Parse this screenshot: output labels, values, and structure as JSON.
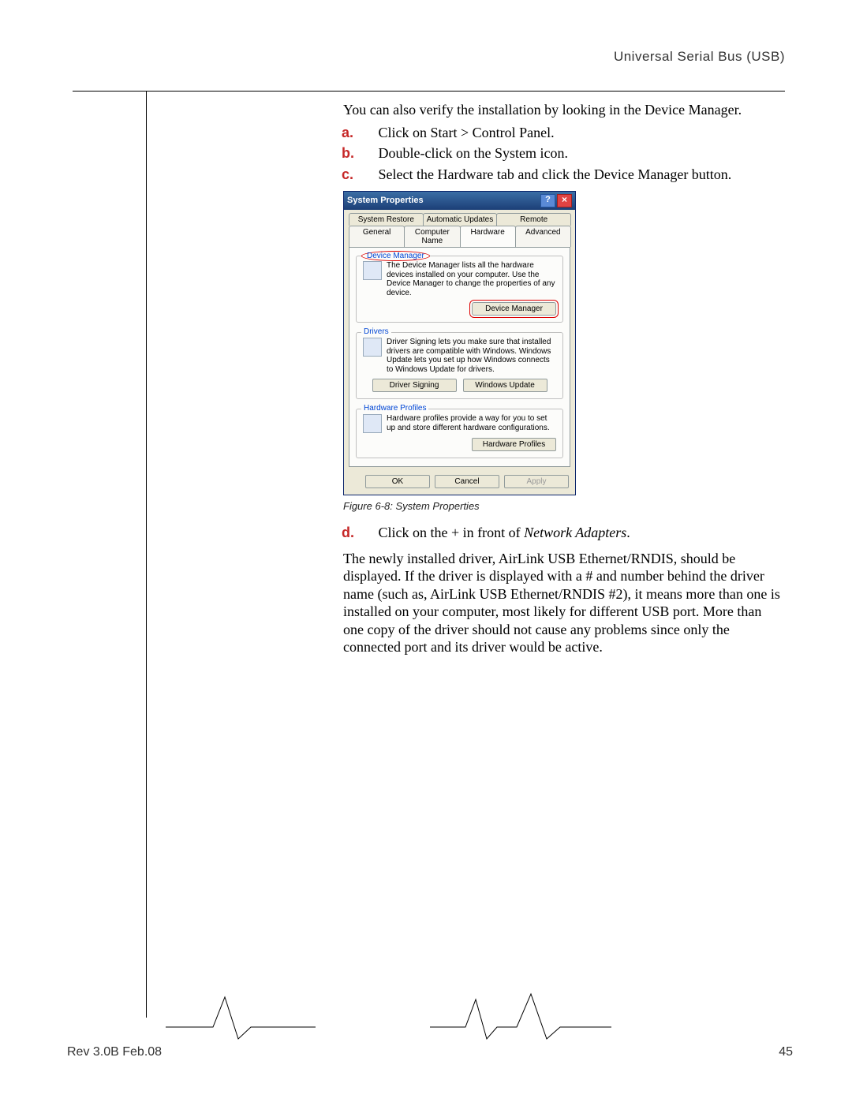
{
  "header": {
    "section_title": "Universal Serial Bus (USB)"
  },
  "intro": "You can also verify the installation by looking in the Device Manager.",
  "steps_abc": [
    {
      "marker": "a.",
      "text": "Click on Start > Control Panel."
    },
    {
      "marker": "b.",
      "text": "Double-click on the System icon."
    },
    {
      "marker": "c.",
      "text": "Select the Hardware tab and click the Device Manager button."
    }
  ],
  "figure_caption": "Figure 6-8:  System Properties",
  "step_d": {
    "marker": "d.",
    "prefix": "Click on the + in front of ",
    "italic": "Network Adapters",
    "suffix": "."
  },
  "body_para": "The newly installed driver, AirLink USB Ethernet/RNDIS, should be displayed. If the driver is displayed with a # and number behind the driver name (such as, AirLink USB Ethernet/RNDIS #2), it means more than one is installed on your computer, most likely for different USB port. More than one copy of the driver should not cause any problems since only the connected port and its driver would be active.",
  "dialog": {
    "title": "System Properties",
    "tabs_back": [
      "System Restore",
      "Automatic Updates",
      "Remote"
    ],
    "tabs_front": [
      "General",
      "Computer Name",
      "Hardware",
      "Advanced"
    ],
    "active_tab": "Hardware",
    "group_devmgr": {
      "legend": "Device Manager",
      "text": "The Device Manager lists all the hardware devices installed on your computer. Use the Device Manager to change the properties of any device.",
      "button": "Device Manager"
    },
    "group_drivers": {
      "legend": "Drivers",
      "text": "Driver Signing lets you make sure that installed drivers are compatible with Windows. Windows Update lets you set up how Windows connects to Windows Update for drivers.",
      "btn1": "Driver Signing",
      "btn2": "Windows Update"
    },
    "group_hw": {
      "legend": "Hardware Profiles",
      "text": "Hardware profiles provide a way for you to set up and store different hardware configurations.",
      "button": "Hardware Profiles"
    },
    "bottom": {
      "ok": "OK",
      "cancel": "Cancel",
      "apply": "Apply"
    }
  },
  "footer": {
    "rev": "Rev 3.0B  Feb.08",
    "page": "45"
  }
}
